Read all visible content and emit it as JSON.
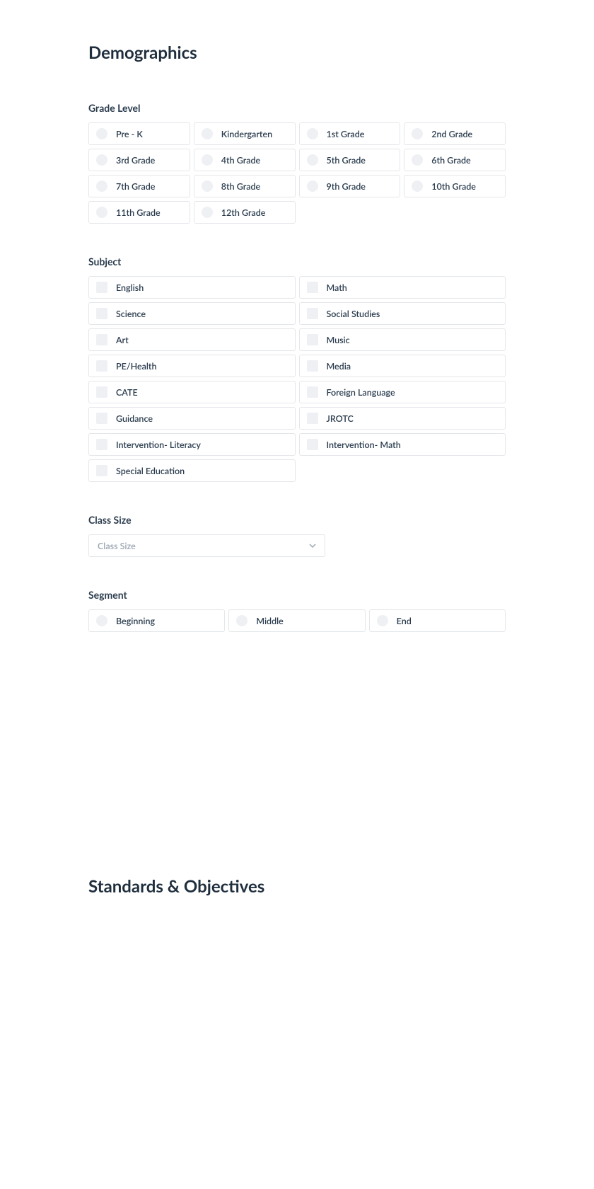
{
  "headings": {
    "page": "Demographics",
    "grade_level": "Grade Level",
    "subject": "Subject",
    "class_size": "Class Size",
    "segment": "Segment",
    "next_section": "Standards & Objectives"
  },
  "grade_levels": [
    "Pre - K",
    "Kindergarten",
    "1st Grade",
    "2nd Grade",
    "3rd Grade",
    "4th Grade",
    "5th Grade",
    "6th Grade",
    "7th Grade",
    "8th Grade",
    "9th Grade",
    "10th Grade",
    "11th Grade",
    "12th Grade"
  ],
  "subjects": [
    "English",
    "Math",
    "Science",
    "Social Studies",
    "Art",
    "Music",
    "PE/Health",
    "Media",
    "CATE",
    "Foreign Language",
    "Guidance",
    "JROTC",
    "Intervention- Literacy",
    "Intervention- Math",
    "Special Education"
  ],
  "class_size": {
    "placeholder": "Class Size",
    "selected": ""
  },
  "segments": [
    "Beginning",
    "Middle",
    "End"
  ]
}
